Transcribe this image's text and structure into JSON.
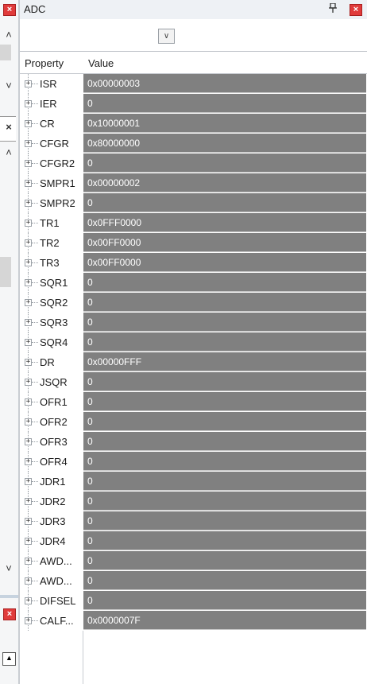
{
  "panel": {
    "title": "ADC",
    "pin_glyph": "ᵒ",
    "close_glyph": "×",
    "dropdown_glyph": "∨"
  },
  "left_strip": {
    "close_glyph": "×",
    "up_arrow": "˄",
    "down_arrow": "˅",
    "x_glyph": "×",
    "scroll_up": "▲"
  },
  "grid": {
    "header_property": "Property",
    "header_value": "Value",
    "rows": [
      {
        "name": "ISR",
        "value": "0x00000003"
      },
      {
        "name": "IER",
        "value": "0"
      },
      {
        "name": "CR",
        "value": "0x10000001"
      },
      {
        "name": "CFGR",
        "value": "0x80000000"
      },
      {
        "name": "CFGR2",
        "value": "0"
      },
      {
        "name": "SMPR1",
        "value": "0x00000002"
      },
      {
        "name": "SMPR2",
        "value": "0"
      },
      {
        "name": "TR1",
        "value": "0x0FFF0000"
      },
      {
        "name": "TR2",
        "value": "0x00FF0000"
      },
      {
        "name": "TR3",
        "value": "0x00FF0000"
      },
      {
        "name": "SQR1",
        "value": "0"
      },
      {
        "name": "SQR2",
        "value": "0"
      },
      {
        "name": "SQR3",
        "value": "0"
      },
      {
        "name": "SQR4",
        "value": "0"
      },
      {
        "name": "DR",
        "value": "0x00000FFF"
      },
      {
        "name": "JSQR",
        "value": "0"
      },
      {
        "name": "OFR1",
        "value": "0"
      },
      {
        "name": "OFR2",
        "value": "0"
      },
      {
        "name": "OFR3",
        "value": "0"
      },
      {
        "name": "OFR4",
        "value": "0"
      },
      {
        "name": "JDR1",
        "value": "0"
      },
      {
        "name": "JDR2",
        "value": "0"
      },
      {
        "name": "JDR3",
        "value": "0"
      },
      {
        "name": "JDR4",
        "value": "0"
      },
      {
        "name": "AWD...",
        "value": "0"
      },
      {
        "name": "AWD...",
        "value": "0"
      },
      {
        "name": "DIFSEL",
        "value": "0"
      },
      {
        "name": "CALF...",
        "value": "0x0000007F"
      }
    ]
  },
  "colors": {
    "value_cell_bg": "#808080",
    "value_cell_text": "#ffffff",
    "close_button": "#e03b3b",
    "title_bar_bg": "#eef1f5"
  },
  "icons": {
    "pin": "pin-icon",
    "close": "close-icon",
    "dropdown": "chevron-down-icon",
    "expander": "plus-expand-icon"
  }
}
